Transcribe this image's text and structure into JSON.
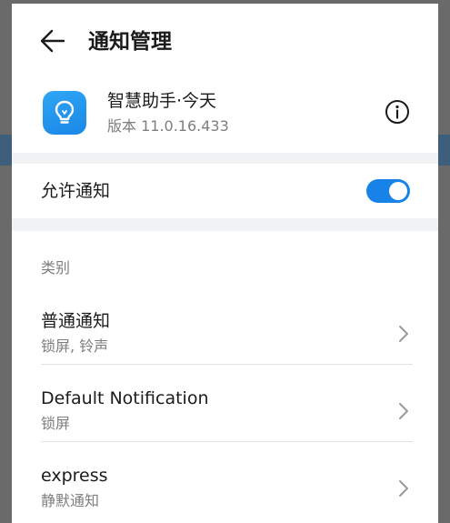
{
  "header": {
    "title": "通知管理",
    "back_icon": "arrow-left-icon"
  },
  "app": {
    "name": "智慧助手·今天",
    "version": "版本 11.0.16.433",
    "icon": "lightbulb-icon",
    "icon_color": "#1a87e6",
    "info_icon": "info-icon"
  },
  "allow": {
    "label": "允许通知",
    "enabled": true,
    "toggle_color": "#1783e8"
  },
  "categories": {
    "section_label": "类别",
    "items": [
      {
        "title": "普通通知",
        "subtitle": "锁屏, 铃声"
      },
      {
        "title": "Default Notification",
        "subtitle": "锁屏"
      },
      {
        "title": "express",
        "subtitle": "静默通知"
      }
    ]
  }
}
